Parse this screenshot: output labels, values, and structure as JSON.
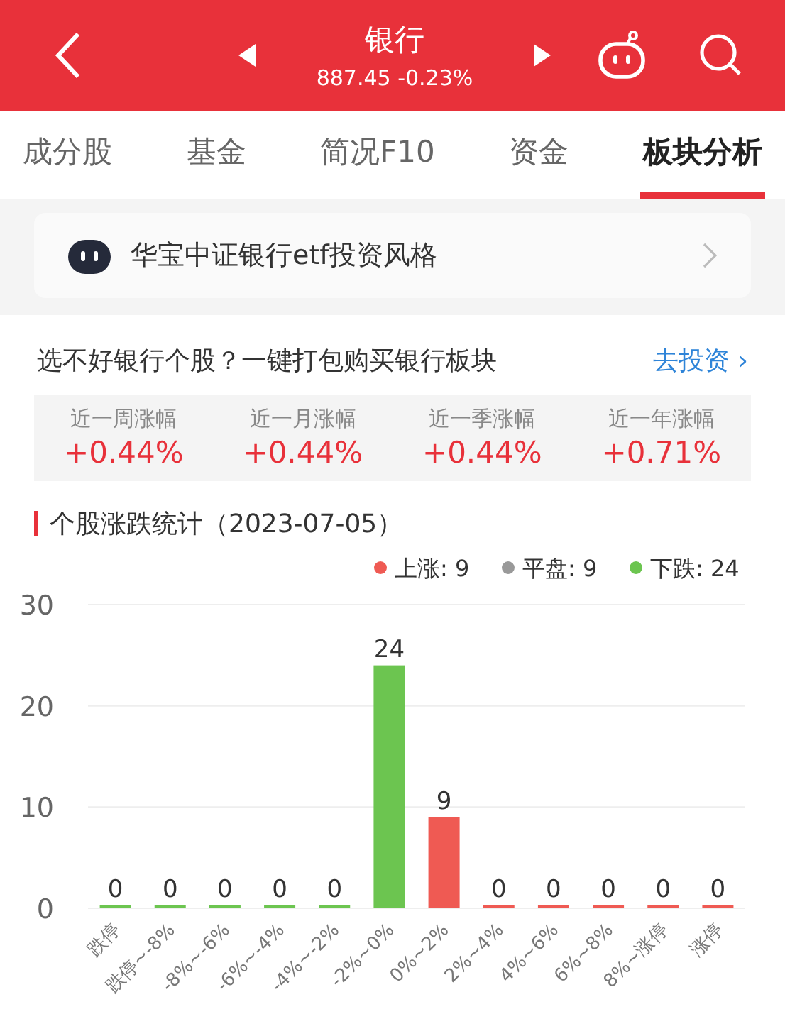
{
  "header": {
    "title": "银行",
    "quote": "887.45 -0.23%"
  },
  "tabs": [
    {
      "label": "成分股",
      "selected": false
    },
    {
      "label": "基金",
      "selected": false
    },
    {
      "label": "简况F10",
      "selected": false
    },
    {
      "label": "资金",
      "selected": false
    },
    {
      "label": "板块分析",
      "selected": true
    }
  ],
  "fund_card": {
    "label": "华宝中证银行etf投资风格"
  },
  "promo": {
    "text": "选不好银行个股？一键打包购买银行板块",
    "link": "去投资 ›"
  },
  "returns": [
    {
      "label": "近一周涨幅",
      "value": "+0.44%"
    },
    {
      "label": "近一月涨幅",
      "value": "+0.44%"
    },
    {
      "label": "近一季涨幅",
      "value": "+0.44%"
    },
    {
      "label": "近一年涨幅",
      "value": "+0.71%"
    }
  ],
  "stats": {
    "title": "个股涨跌统计（2023-07-05）",
    "legend": [
      {
        "label": "上涨: 9",
        "color": "#ef5a53"
      },
      {
        "label": "平盘: 9",
        "color": "#999999"
      },
      {
        "label": "下跌: 24",
        "color": "#6cc550"
      }
    ],
    "chart_data": {
      "type": "bar",
      "data_labels": true,
      "categories": [
        "跌停",
        "跌停~-8%",
        "-8%~-6%",
        "-6%~-4%",
        "-4%~-2%",
        "-2%~0%",
        "0%~2%",
        "2%~4%",
        "4%~6%",
        "6%~8%",
        "8%~涨停",
        "涨停"
      ],
      "yticks": [
        0,
        10,
        20,
        30
      ],
      "ylim": [
        0,
        30
      ],
      "values": [
        0,
        0,
        0,
        0,
        0,
        24,
        9,
        0,
        0,
        0,
        0,
        0
      ],
      "colors": [
        "#6cc550",
        "#6cc550",
        "#6cc550",
        "#6cc550",
        "#6cc550",
        "#6cc550",
        "#ef5a53",
        "#ef5a53",
        "#ef5a53",
        "#ef5a53",
        "#ef5a53",
        "#ef5a53"
      ]
    }
  }
}
